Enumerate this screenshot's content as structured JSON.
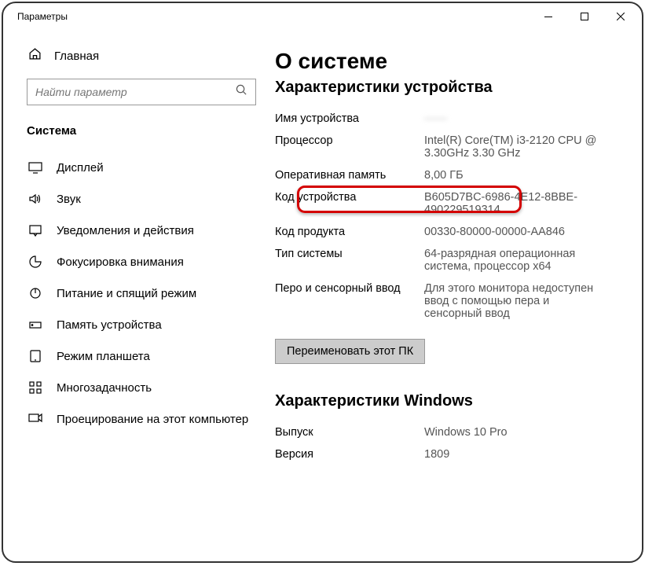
{
  "window": {
    "title": "Параметры"
  },
  "sidebar": {
    "home_label": "Главная",
    "search_placeholder": "Найти параметр",
    "category": "Система",
    "items": [
      {
        "label": "Дисплей",
        "icon": "display-icon"
      },
      {
        "label": "Звук",
        "icon": "sound-icon"
      },
      {
        "label": "Уведомления и действия",
        "icon": "notifications-icon"
      },
      {
        "label": "Фокусировка внимания",
        "icon": "focus-icon"
      },
      {
        "label": "Питание и спящий режим",
        "icon": "power-icon"
      },
      {
        "label": "Память устройства",
        "icon": "storage-icon"
      },
      {
        "label": "Режим планшета",
        "icon": "tablet-icon"
      },
      {
        "label": "Многозадачность",
        "icon": "multitask-icon"
      },
      {
        "label": "Проецирование на этот компьютер",
        "icon": "project-icon"
      }
    ]
  },
  "main": {
    "title": "О системе",
    "section1_title": "Характеристики устройства",
    "specs": [
      {
        "label": "Имя устройства",
        "value": "——",
        "blurred": true
      },
      {
        "label": "Процессор",
        "value": "Intel(R) Core(TM) i3-2120 CPU @ 3.30GHz   3.30 GHz"
      },
      {
        "label": "Оперативная память",
        "value": "8,00 ГБ"
      },
      {
        "label": "Код устройства",
        "value": "B605D7BC-6986-4E12-8BBE-490229519314"
      },
      {
        "label": "Код продукта",
        "value": "00330-80000-00000-AA846"
      },
      {
        "label": "Тип системы",
        "value": "64-разрядная операционная система, процессор x64"
      },
      {
        "label": "Перо и сенсорный ввод",
        "value": "Для этого монитора недоступен ввод с помощью пера и сенсорный ввод"
      }
    ],
    "rename_label": "Переименовать этот ПК",
    "section2_title": "Характеристики Windows",
    "specs2": [
      {
        "label": "Выпуск",
        "value": "Windows 10 Pro"
      },
      {
        "label": "Версия",
        "value": "1809"
      }
    ]
  }
}
